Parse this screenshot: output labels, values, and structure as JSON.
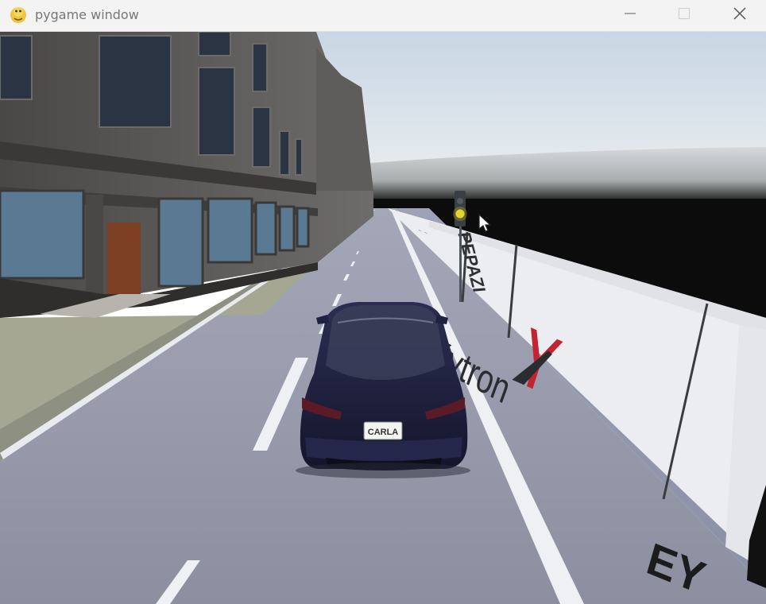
{
  "window": {
    "title": "pygame window",
    "icons": {
      "app": "pygame-snake-icon",
      "minimize": "minimize-icon",
      "maximize": "maximize-icon",
      "close": "close-icon"
    }
  },
  "scene": {
    "billboard_brand": "Xytron",
    "billboard_fragment": "EY",
    "billboard_small_text": "PEPAZI",
    "license_plate": "CARLA",
    "traffic_light_state": "yellow",
    "cursor_icon": "mouse-pointer-icon",
    "colors": {
      "sky": "#dfe7ef",
      "road": "#8e92a3",
      "car": "#1e2140",
      "wall": "#ecedf0",
      "brand_red": "#c4242f"
    }
  }
}
